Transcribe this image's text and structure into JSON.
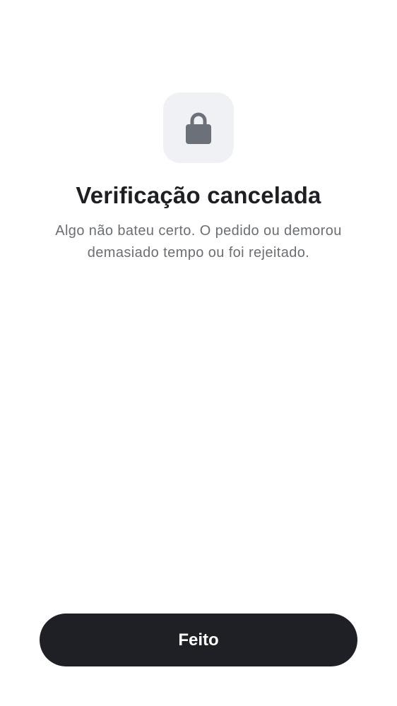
{
  "status": {
    "icon": "lock-icon",
    "title": "Verificação cancelada",
    "message": "Algo não bateu certo. O pedido ou demorou demasiado tempo ou foi rejeitado."
  },
  "actions": {
    "done_label": "Feito"
  },
  "colors": {
    "background": "#ffffff",
    "icon_tile": "#f0f1f5",
    "icon": "#6b7079",
    "title": "#1e1f23",
    "message": "#6b6e75",
    "button_bg": "#1f2025",
    "button_text": "#ffffff"
  }
}
